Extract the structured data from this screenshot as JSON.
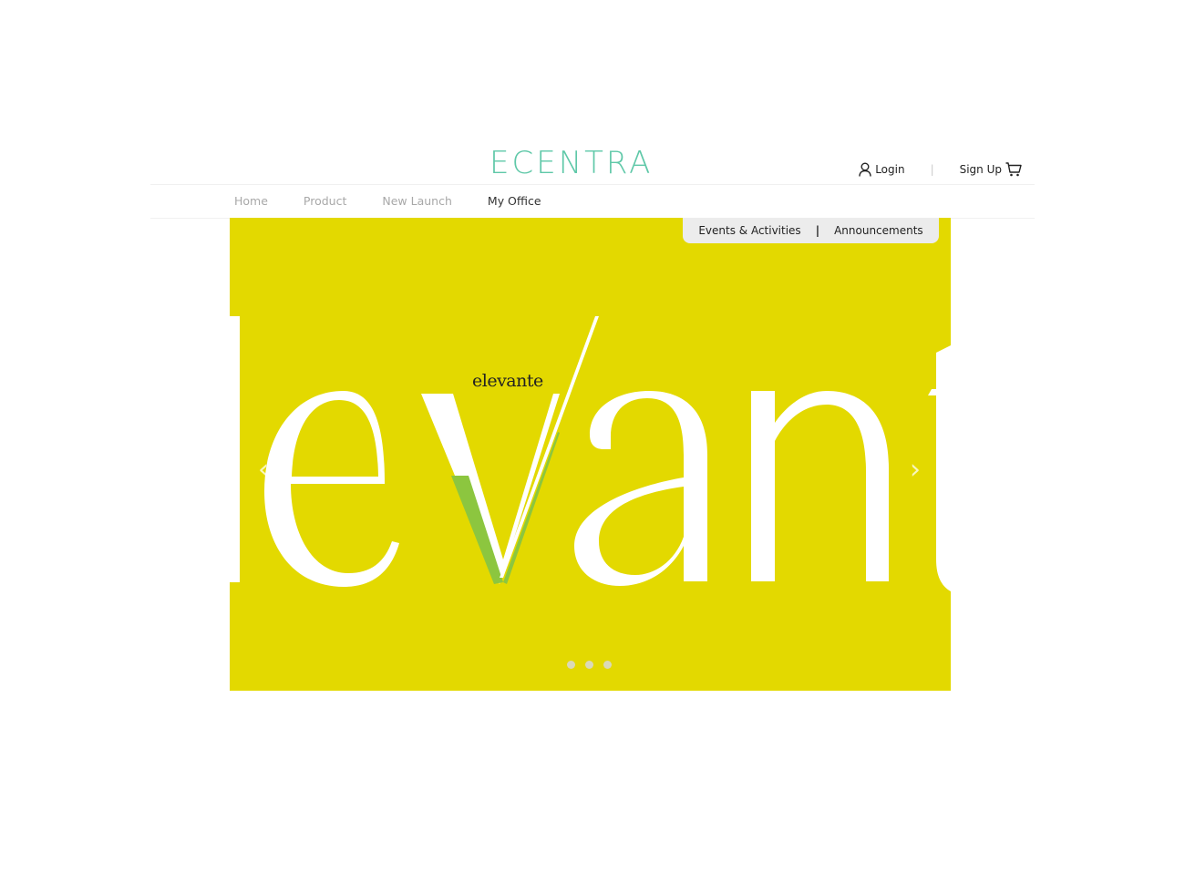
{
  "brand": {
    "name": "ECENTRA",
    "color": "#5fc8a8"
  },
  "user": {
    "login_label": "Login",
    "signup_label": "Sign Up"
  },
  "nav": {
    "items": [
      {
        "label": "Home"
      },
      {
        "label": "Product"
      },
      {
        "label": "New Launch"
      },
      {
        "label": "My Office",
        "active": true
      }
    ]
  },
  "hero": {
    "background": "#e3d900",
    "subtabs": [
      "Events & Activities",
      "Announcements"
    ],
    "small_brand": "elevante",
    "big_text": "levante",
    "accent": "#8cc63f",
    "slides": 3
  }
}
